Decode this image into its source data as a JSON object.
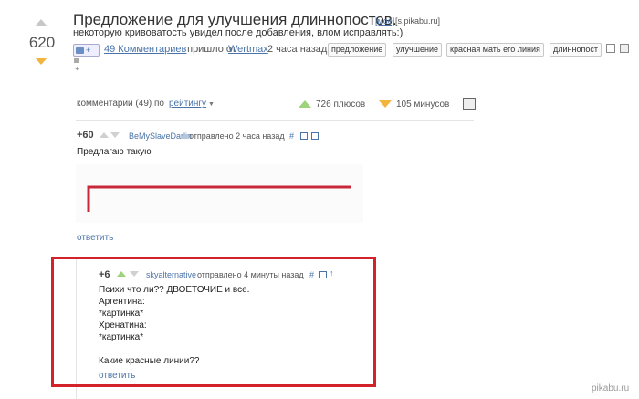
{
  "post": {
    "rating": "620",
    "title": "Предложение для улучшения длиннопостов.",
    "mine_tag": "[моё]",
    "source": "[s.pikabu.ru]",
    "description_line1": "некоторую кривоватость увидел после добавления, влом исправлять:)",
    "share_count": "+",
    "comments_link": "49 Комментариев",
    "posted_by_prefix": "; пришло от",
    "author": "Wertmax",
    "time_ago": "2 часа назад",
    "tags": [
      "предложение",
      "улучшение",
      "красная мать его линия",
      "длиннопост"
    ]
  },
  "comments_bar": {
    "label": "комментарии (49) по",
    "sort_select": "рейтингу",
    "pluses": "726 плюсов",
    "minuses": "105 минусов"
  },
  "comment1": {
    "score": "+60",
    "author": "BeMySlaveDarlin",
    "meta": "отправлено 2 часа назад",
    "hash": "#",
    "text": "Предлагаю такую",
    "reply": "ответить"
  },
  "comment2": {
    "score": "+6",
    "author": "skyalternative",
    "meta": "отправлено 4 минуты назад",
    "hash": "#",
    "lines": [
      "Психи что ли?? ДВОЕТОЧИЕ и все.",
      "Аргентина:",
      "*картинка*",
      "Хренатина:",
      "*картинка*",
      "",
      "Какие красные линии??"
    ],
    "reply": "ответить"
  },
  "watermark": "pikabu.ru",
  "colors": {
    "highlight_border": "#d4222a",
    "red_line": "#c8283a",
    "plus_green": "#9ed37b",
    "minus_orange": "#f2b43c",
    "link_blue": "#4a74a8"
  }
}
